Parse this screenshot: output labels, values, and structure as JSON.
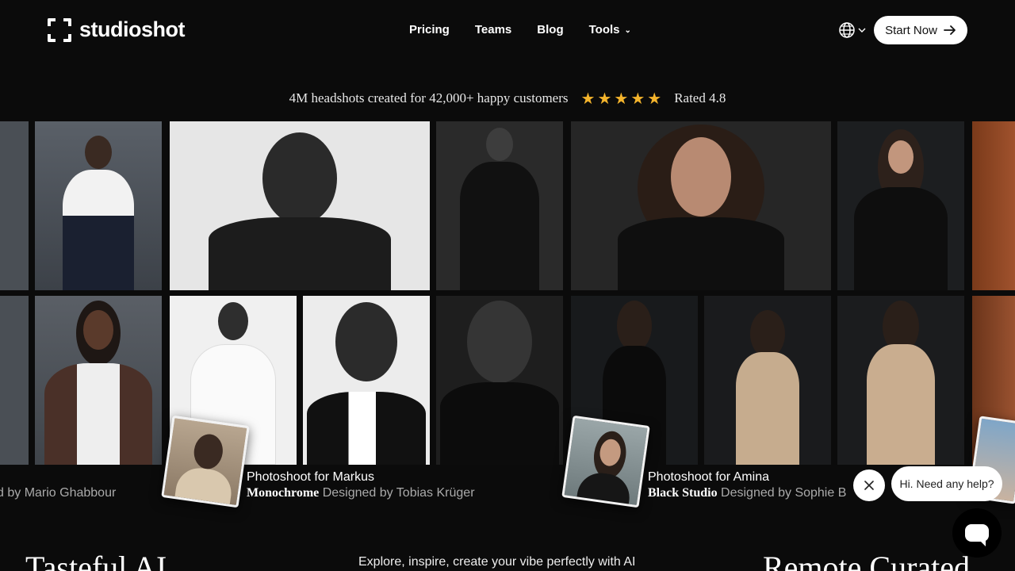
{
  "header": {
    "brand": "studioshot",
    "nav": [
      {
        "label": "Pricing"
      },
      {
        "label": "Teams"
      },
      {
        "label": "Blog"
      },
      {
        "label": "Tools"
      }
    ],
    "start_label": "Start Now"
  },
  "tagline": {
    "text": "4M headshots created for 42,000+ happy customers",
    "rating_stars": 5,
    "rating_text": "Rated 4.8",
    "star_color": "#f4b42c"
  },
  "captions": {
    "left_partial": "d by Mario Ghabbour",
    "markus": {
      "title": "Photoshoot for Markus",
      "style": "Monochrome",
      "designer": "Designed by Tobias Krüger"
    },
    "amina": {
      "title": "Photoshoot for Amina",
      "style": "Black Studio",
      "designer": "Designed by Sophie B"
    }
  },
  "chat": {
    "greeting": "Hi. Need any help?"
  },
  "bottom": {
    "left_heading": "Tasteful AI",
    "mid_text": "Explore, inspire, create your vibe perfectly with AI",
    "right_heading": "Remote Curated"
  }
}
